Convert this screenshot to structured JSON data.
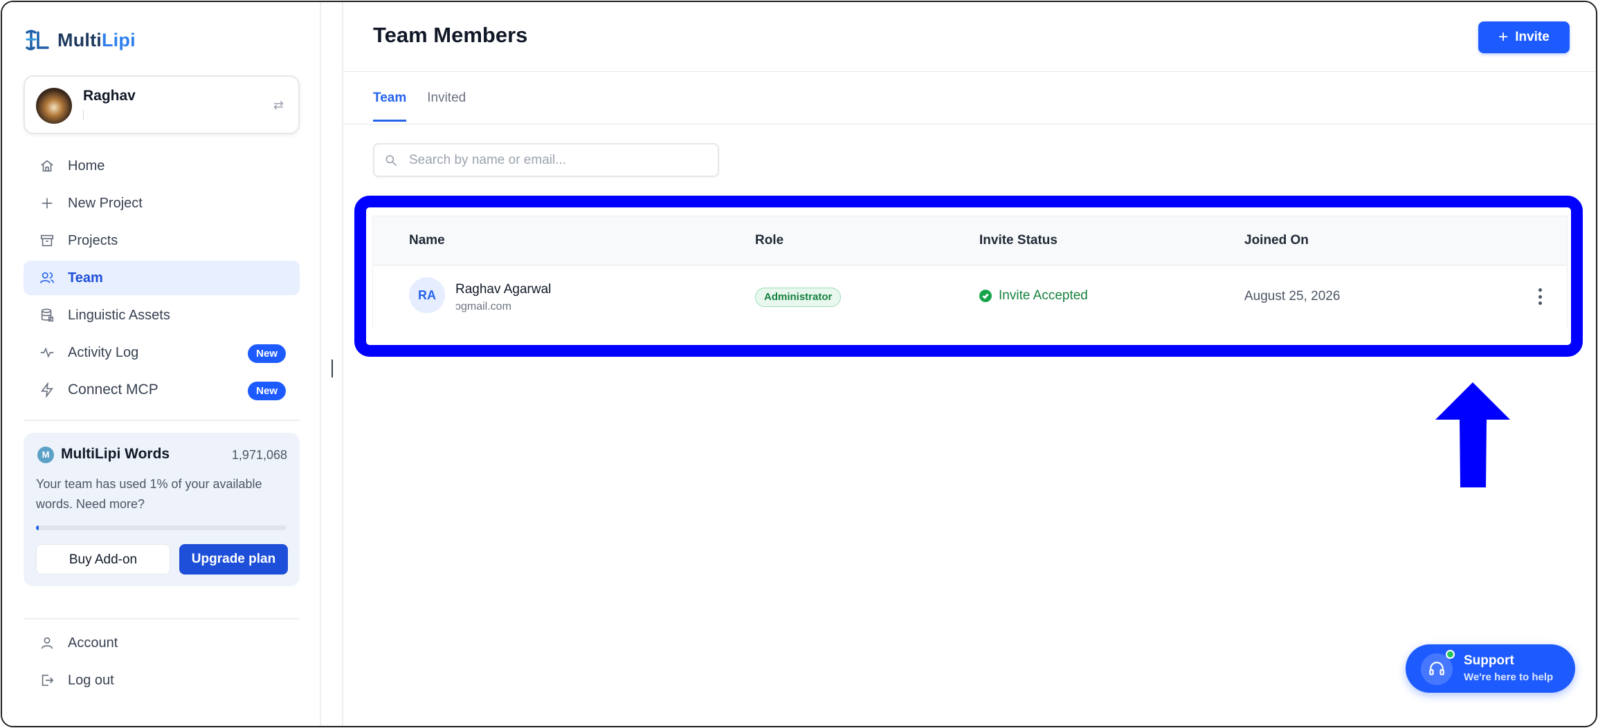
{
  "app": {
    "logo_prefix": "Multi",
    "logo_suffix": "Lipi"
  },
  "profile": {
    "name": "Raghav"
  },
  "sidebar": {
    "items": [
      {
        "label": "Home",
        "icon": "home-icon"
      },
      {
        "label": "New Project",
        "icon": "plus-icon"
      },
      {
        "label": "Projects",
        "icon": "archive-icon"
      },
      {
        "label": "Team",
        "icon": "users-icon",
        "active": true
      },
      {
        "label": "Linguistic Assets",
        "icon": "database-icon"
      },
      {
        "label": "Activity Log",
        "icon": "activity-icon",
        "badge": "New"
      },
      {
        "label": "Connect MCP",
        "icon": "bolt-icon",
        "badge": "New"
      }
    ],
    "bottom": [
      {
        "label": "Account",
        "icon": "user-icon"
      },
      {
        "label": "Log out",
        "icon": "logout-icon"
      }
    ]
  },
  "words": {
    "title": "MultiLipi Words",
    "icon_letter": "M",
    "count": "1,971,068",
    "description": "Your team has used 1% of your available words. Need more?",
    "usage_percent": 1,
    "buy_label": "Buy Add-on",
    "upgrade_label": "Upgrade plan"
  },
  "header": {
    "title": "Team Members",
    "invite_label": "Invite"
  },
  "tabs": [
    {
      "label": "Team",
      "active": true
    },
    {
      "label": "Invited",
      "active": false
    }
  ],
  "search": {
    "placeholder": "Search by name or email...",
    "value": ""
  },
  "table": {
    "columns": [
      "Name",
      "Role",
      "Invite Status",
      "Joined On"
    ],
    "rows": [
      {
        "initials": "RA",
        "name": "Raghav Agarwal",
        "email": "ɔgmail.com",
        "role": "Administrator",
        "status": "Invite Accepted",
        "joined": "August 25, 2026"
      }
    ]
  },
  "support": {
    "title": "Support",
    "subtitle": "We're here to help"
  },
  "colors": {
    "accent": "#1e5bff",
    "annotation": "#0000ff",
    "success": "#16a34a"
  }
}
